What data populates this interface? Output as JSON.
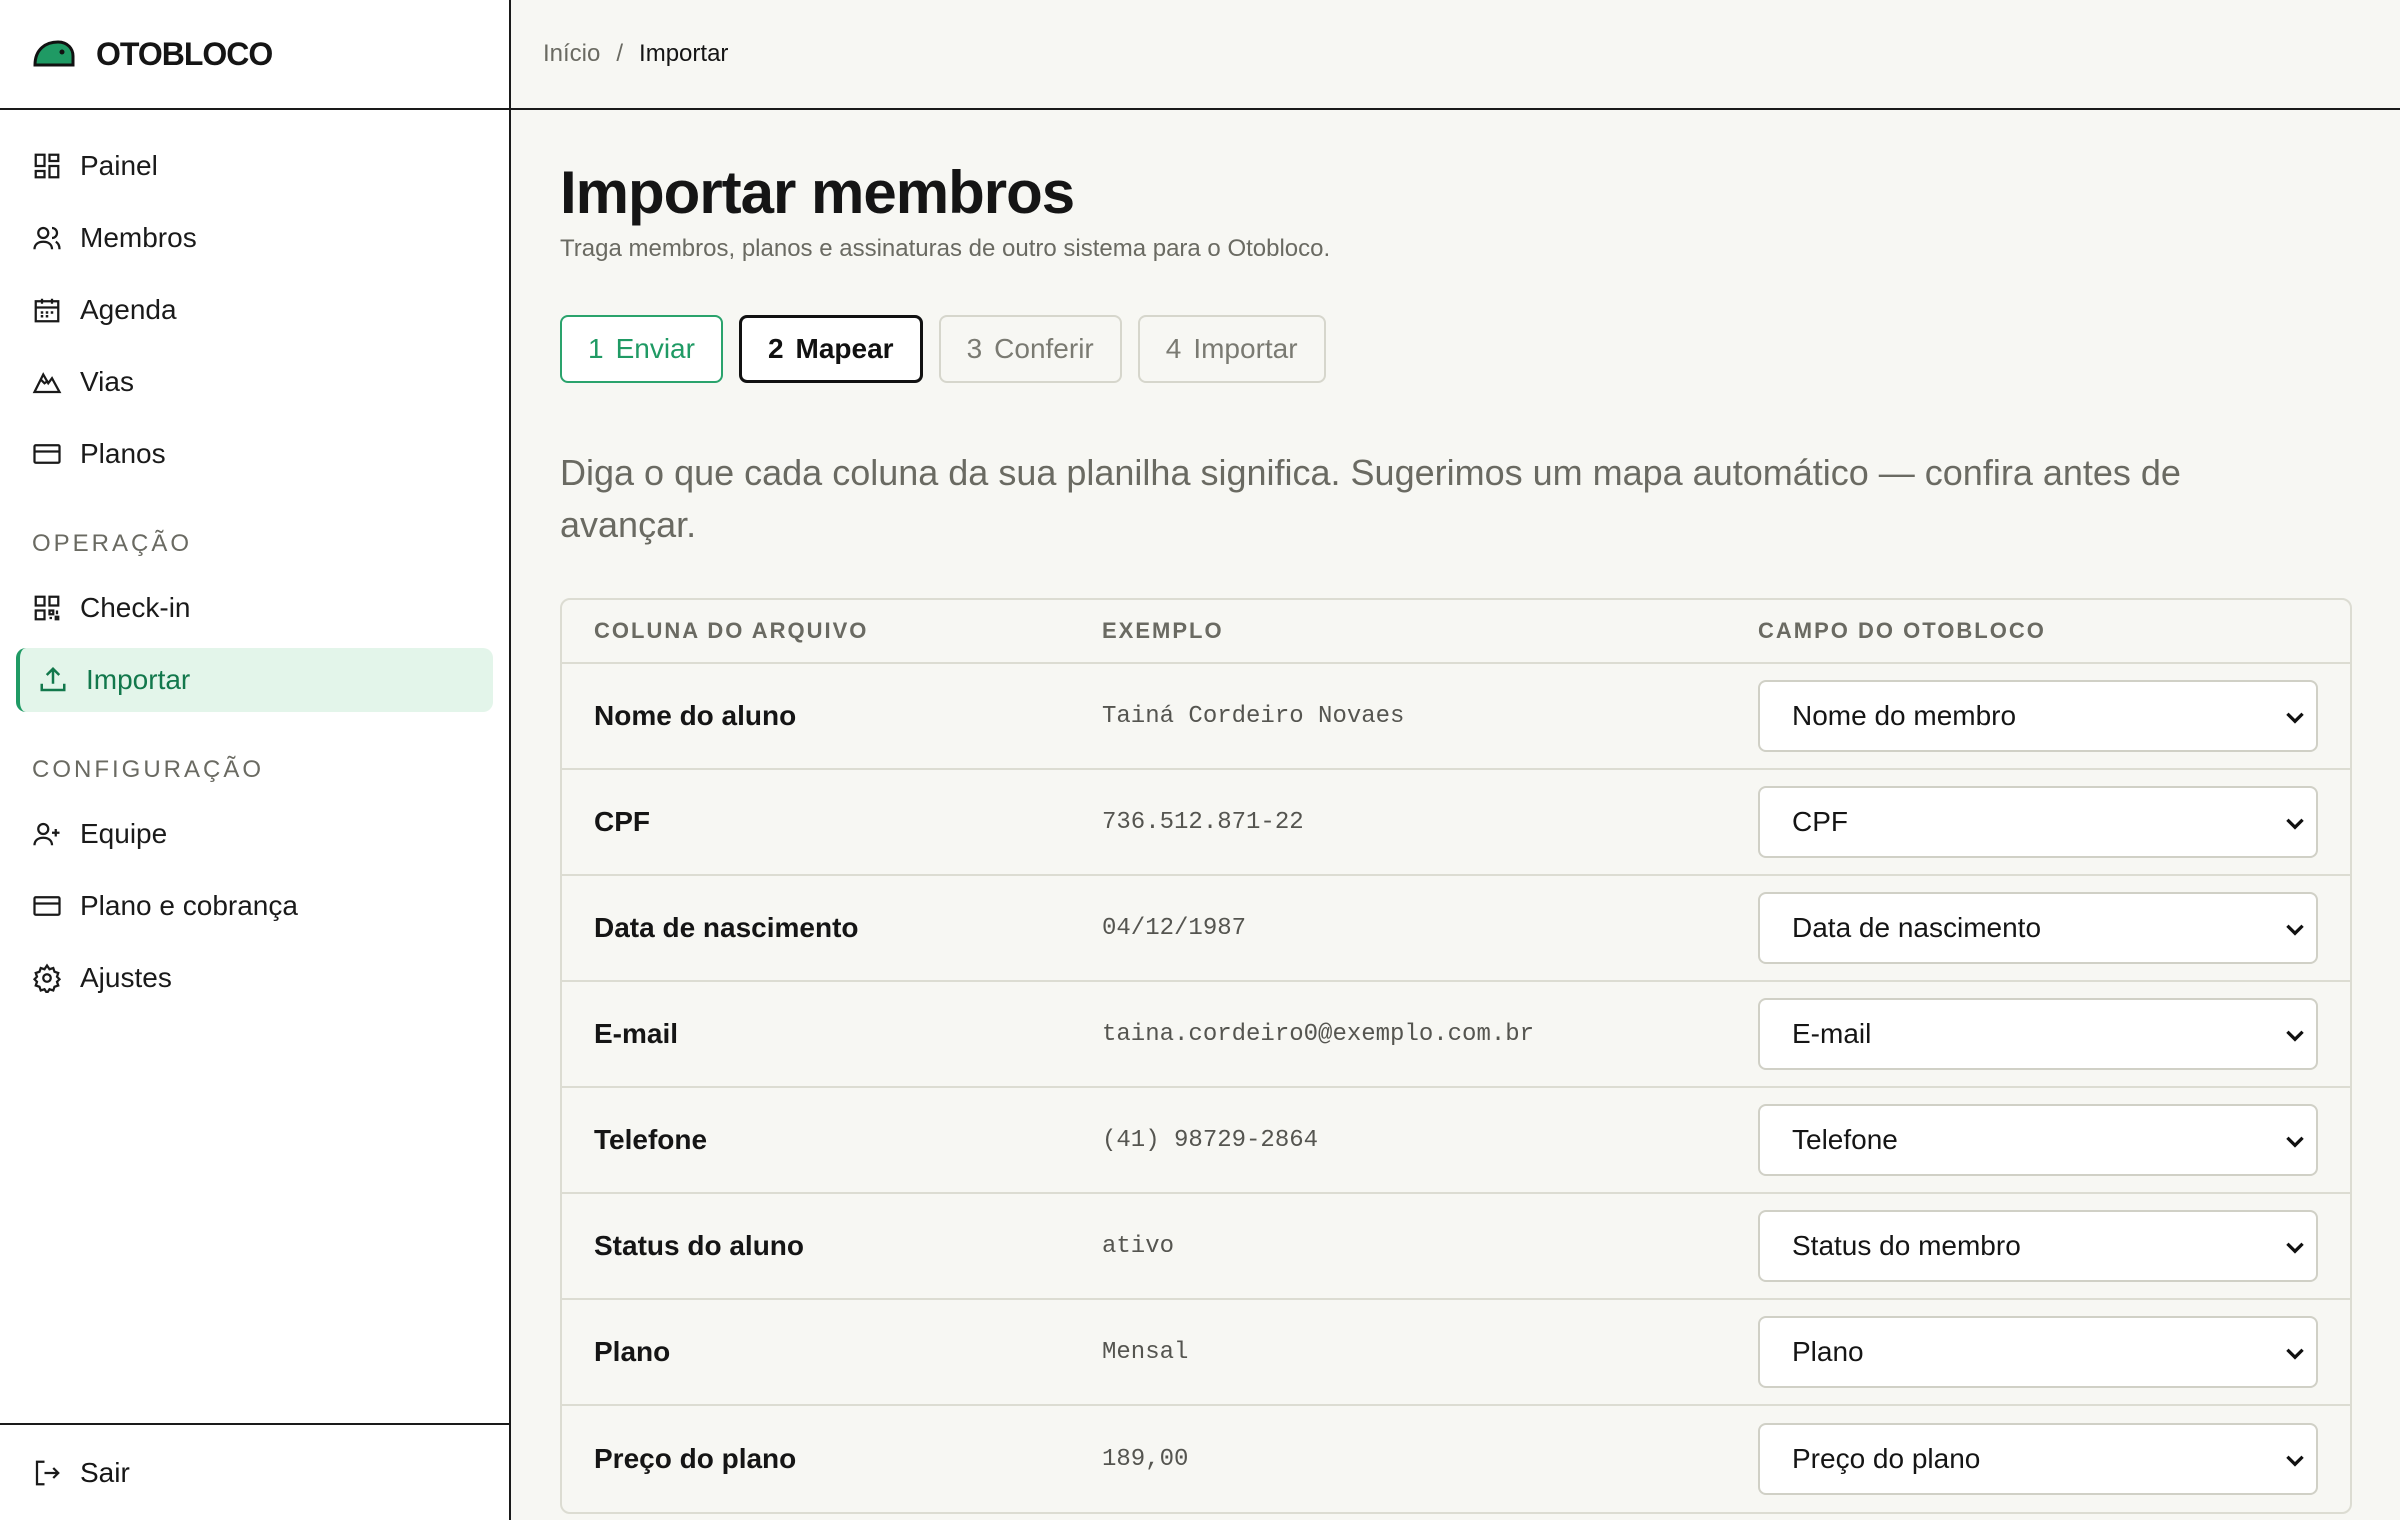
{
  "brand": {
    "name": "OTOBLOCO",
    "accent": "#1f9a64"
  },
  "sidebar": {
    "items": [
      {
        "label": "Painel",
        "icon": "grid-icon"
      },
      {
        "label": "Membros",
        "icon": "users-icon"
      },
      {
        "label": "Agenda",
        "icon": "calendar-icon"
      },
      {
        "label": "Vias",
        "icon": "mountain-icon"
      },
      {
        "label": "Planos",
        "icon": "card-icon"
      }
    ],
    "section_operacao": "OPERAÇÃO",
    "operacao_items": [
      {
        "label": "Check-in",
        "icon": "qr-icon"
      },
      {
        "label": "Importar",
        "icon": "upload-icon",
        "active": true
      }
    ],
    "section_config": "CONFIGURAÇÃO",
    "config_items": [
      {
        "label": "Equipe",
        "icon": "user-plus-icon"
      },
      {
        "label": "Plano e cobrança",
        "icon": "card-icon"
      },
      {
        "label": "Ajustes",
        "icon": "gear-icon"
      }
    ],
    "logout": "Sair"
  },
  "breadcrumb": {
    "home": "Início",
    "sep": "/",
    "current": "Importar"
  },
  "page": {
    "title": "Importar membros",
    "subtitle": "Traga membros, planos e assinaturas de outro sistema para o Otobloco.",
    "intro": "Diga o que cada coluna da sua planilha significa. Sugerimos um mapa automático — confira antes de avançar."
  },
  "steps": [
    {
      "num": "1",
      "label": "Enviar",
      "state": "done"
    },
    {
      "num": "2",
      "label": "Mapear",
      "state": "current"
    },
    {
      "num": "3",
      "label": "Conferir",
      "state": "pending"
    },
    {
      "num": "4",
      "label": "Importar",
      "state": "pending"
    }
  ],
  "table": {
    "headers": [
      "COLUNA DO ARQUIVO",
      "EXEMPLO",
      "CAMPO DO OTOBLOCO"
    ],
    "rows": [
      {
        "column": "Nome do aluno",
        "example": "Tainá Cordeiro Novaes",
        "field": "Nome do membro"
      },
      {
        "column": "CPF",
        "example": "736.512.871-22",
        "field": "CPF"
      },
      {
        "column": "Data de nascimento",
        "example": "04/12/1987",
        "field": "Data de nascimento"
      },
      {
        "column": "E-mail",
        "example": "taina.cordeiro0@exemplo.com.br",
        "field": "E-mail"
      },
      {
        "column": "Telefone",
        "example": "(41) 98729-2864",
        "field": "Telefone"
      },
      {
        "column": "Status do aluno",
        "example": "ativo",
        "field": "Status do membro"
      },
      {
        "column": "Plano",
        "example": "Mensal",
        "field": "Plano"
      },
      {
        "column": "Preço do plano",
        "example": "189,00",
        "field": "Preço do plano"
      }
    ]
  }
}
